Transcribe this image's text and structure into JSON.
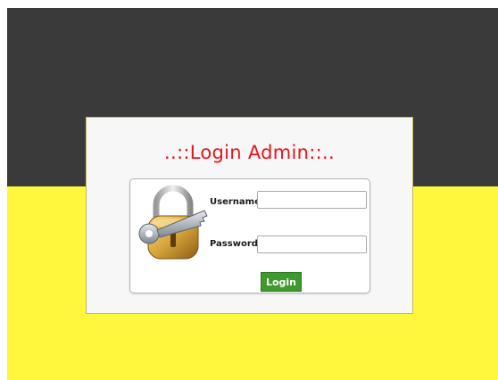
{
  "page": {
    "background_top_color": "#3a3a3a",
    "background_bottom_color": "#fff73b"
  },
  "login": {
    "title": "..::Login Admin::..",
    "title_color": "#e8141a",
    "icon": "padlock-key-icon",
    "username_label": "Username :",
    "username_value": "",
    "password_label": "Password :",
    "password_value": "",
    "submit_label": "Login",
    "submit_color": "#3e9a2c"
  }
}
